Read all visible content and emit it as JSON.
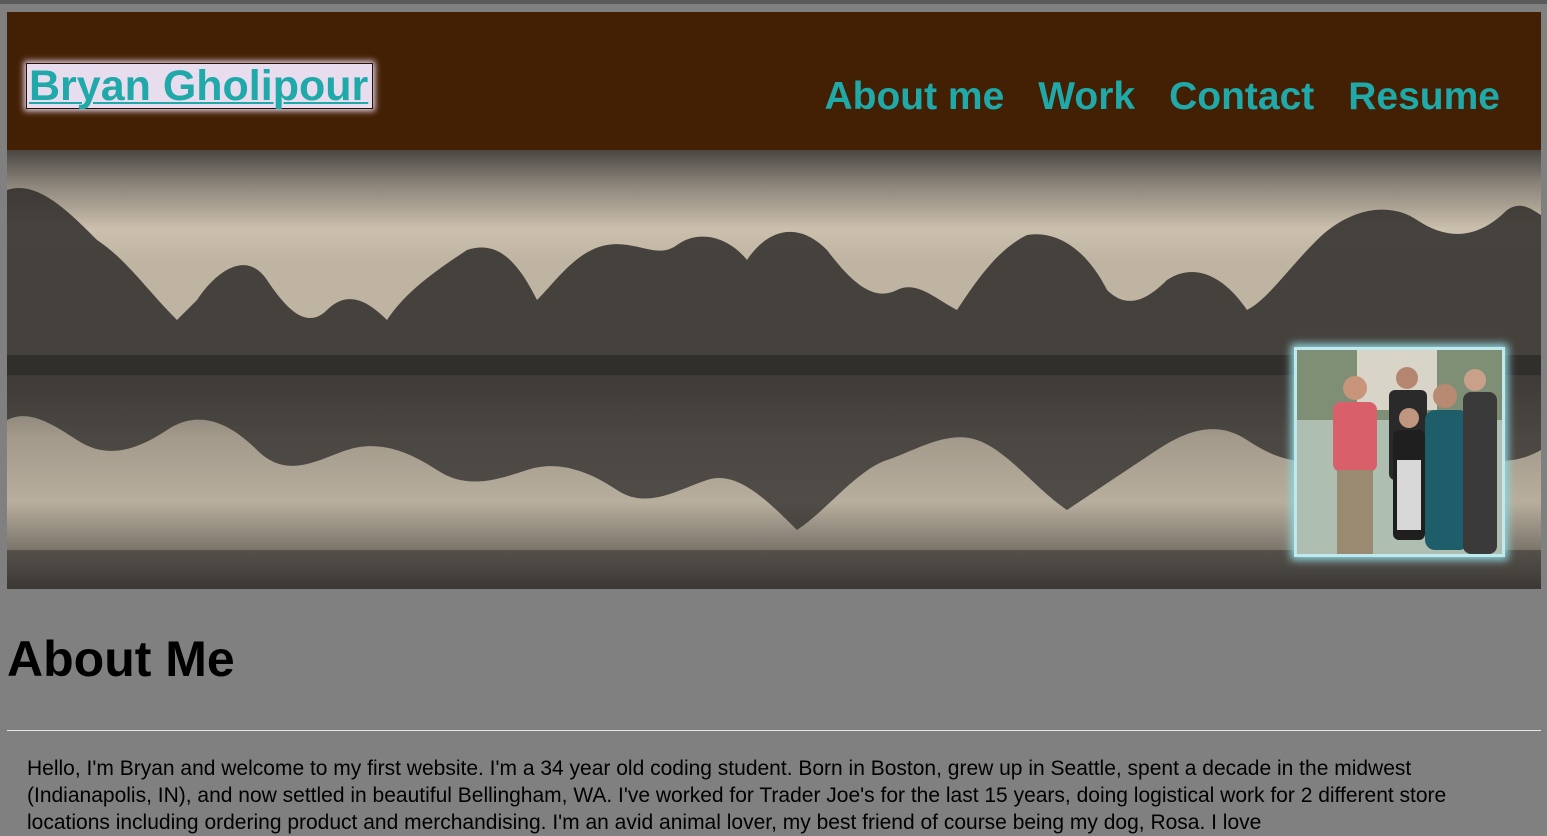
{
  "header": {
    "logo_text": "Bryan Gholipour",
    "nav": [
      {
        "label": "About me"
      },
      {
        "label": "Work"
      },
      {
        "label": "Contact"
      },
      {
        "label": "Resume"
      }
    ]
  },
  "hero": {
    "landscape": "sepia-lake-trees-reflection",
    "family_photo": "family-group-photo"
  },
  "main": {
    "title": "About Me",
    "intro": "Hello, I'm Bryan and welcome to my first website. I'm a 34 year old coding student. Born in Boston, grew up in Seattle, spent a decade in the midwest (Indianapolis, IN), and now settled in beautiful Bellingham, WA. I've worked for Trader Joe's for the last 15 years, doing logistical work for 2 different store locations including ordering product and merchandising. I'm an avid animal lover, my best friend of course being my dog, Rosa. I love"
  },
  "colors": {
    "header_bg": "#431f04",
    "accent": "#1fa9a8",
    "page_bg": "#808080",
    "logo_bg": "#e8dcef",
    "photo_border": "#bfe9ee"
  }
}
